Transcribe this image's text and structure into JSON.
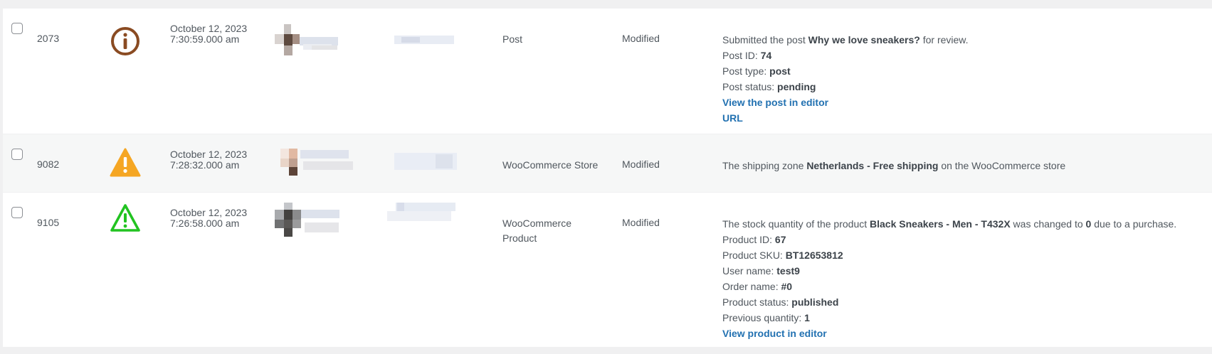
{
  "rows": [
    {
      "id": "2073",
      "severity": "info-icon",
      "severity_color": "#8a4b22",
      "date": "October 12, 2023",
      "time": "7:30:59.000 am",
      "object": "Post",
      "event_type": "Modified",
      "message": {
        "l1_prefix": "Submitted the post ",
        "l1_bold": "Why we love sneakers?",
        "l1_suffix": " for review.",
        "post_id_label": "Post ID: ",
        "post_id": "74",
        "post_type_label": "Post type: ",
        "post_type": "post",
        "post_status_label": "Post status: ",
        "post_status": "pending",
        "link_editor": "View the post in editor",
        "link_url": "URL"
      }
    },
    {
      "id": "9082",
      "severity": "warning-filled-icon",
      "severity_color": "#f5a623",
      "date": "October 12, 2023",
      "time": "7:28:32.000 am",
      "object": "WooCommerce Store",
      "event_type": "Modified",
      "message": {
        "prefix": "The shipping zone ",
        "bold": "Netherlands - Free shipping",
        "suffix": " on the WooCommerce store"
      }
    },
    {
      "id": "9105",
      "severity": "warning-outline-icon",
      "severity_color": "#22c321",
      "date": "October 12, 2023",
      "time": "7:26:58.000 am",
      "object_line1": "WooCommerce",
      "object_line2": "Product",
      "event_type": "Modified",
      "message": {
        "l1_prefix": "The stock quantity of the product ",
        "l1_bold": "Black Sneakers - Men - T432X",
        "l1_mid": " was changed to ",
        "l1_bold2": "0",
        "l1_suffix": " due to a purchase.",
        "product_id_label": "Product ID: ",
        "product_id": "67",
        "sku_label": "Product SKU: ",
        "sku": "BT12653812",
        "user_label": "User name: ",
        "user": "test9",
        "order_label": "Order name: ",
        "order": "#0",
        "status_label": "Product status: ",
        "status": "published",
        "prev_label": "Previous quantity: ",
        "prev": "1",
        "link_editor": "View product in editor"
      }
    }
  ]
}
